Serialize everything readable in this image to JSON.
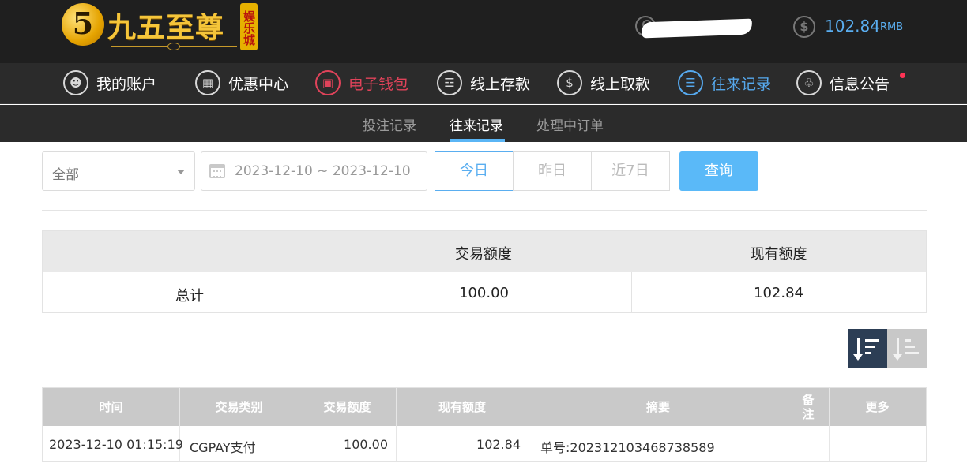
{
  "header": {
    "logo": {
      "mark": "5",
      "name": "九五至尊",
      "badge": "娱乐城"
    },
    "user": {
      "icon": "user-icon",
      "name": ""
    },
    "balance": {
      "icon": "dollar-coin-icon",
      "amount": "102.84",
      "unit": "RMB"
    }
  },
  "nav": {
    "items": [
      {
        "label": "我的账户",
        "icon": "user-circle-icon"
      },
      {
        "label": "优惠中心",
        "icon": "gift-icon"
      },
      {
        "label": "电子钱包",
        "icon": "wallet-icon"
      },
      {
        "label": "线上存款",
        "icon": "deposit-icon"
      },
      {
        "label": "线上取款",
        "icon": "withdraw-icon"
      },
      {
        "label": "往来记录",
        "icon": "records-icon"
      },
      {
        "label": "信息公告",
        "icon": "bell-icon"
      }
    ]
  },
  "subnav": {
    "tabs": [
      "投注记录",
      "往来记录",
      "处理中订单"
    ],
    "active": "往来记录"
  },
  "filter": {
    "type_select": "全部",
    "date_range": "2023-12-10 ~ 2023-12-10",
    "ranges": [
      "今日",
      "昨日",
      "近7日"
    ],
    "active_range": "今日",
    "query_label": "查询"
  },
  "summary": {
    "headers": [
      "交易额度",
      "现有额度"
    ],
    "row_label": "总计",
    "transaction_amount": "100.00",
    "current_balance": "102.84"
  },
  "records": {
    "columns": [
      "时间",
      "交易类别",
      "交易额度",
      "现有额度",
      "摘要",
      "备注",
      "更多"
    ],
    "rows": [
      {
        "time": "2023-12-10 01:15:19",
        "type": "CGPAY支付",
        "amount": "100.00",
        "balance": "102.84",
        "summary": "单号:202312103468738589",
        "remark": "",
        "more": ""
      }
    ]
  },
  "colors": {
    "accent_blue": "#5aaef0",
    "accent_red": "#e0435a",
    "header_bg": "#1f1f1f",
    "nav_bg": "#2b2b2b",
    "sort_active": "#2c3e55"
  }
}
